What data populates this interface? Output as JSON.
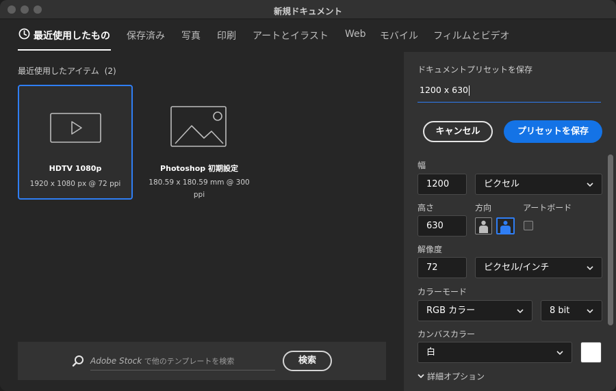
{
  "window": {
    "title": "新規ドキュメント"
  },
  "tabs": [
    {
      "label": "最近使用したもの",
      "active": true
    },
    {
      "label": "保存済み"
    },
    {
      "label": "写真"
    },
    {
      "label": "印刷"
    },
    {
      "label": "アートとイラスト"
    },
    {
      "label": "Web"
    },
    {
      "label": "モバイル"
    },
    {
      "label": "フィルムとビデオ"
    }
  ],
  "recent": {
    "title": "最近使用したアイテム",
    "count": "(2)",
    "items": [
      {
        "name": "HDTV 1080p",
        "detail": "1920 x 1080 px @ 72 ppi",
        "icon": "video-icon",
        "selected": true
      },
      {
        "name": "Photoshop 初期設定",
        "detail": "180.59 x 180.59 mm @ 300 ppi",
        "icon": "image-icon",
        "selected": false
      }
    ]
  },
  "search": {
    "placeholder_brand": "Adobe Stock",
    "placeholder_rest": " で他のテンプレートを検索",
    "button": "検索"
  },
  "preset": {
    "label": "ドキュメントプリセットを保存",
    "value": "1200 x 630",
    "cancel": "キャンセル",
    "save": "プリセットを保存"
  },
  "settings": {
    "width_label": "幅",
    "width_value": "1200",
    "width_unit": "ピクセル",
    "height_label": "高さ",
    "height_value": "630",
    "orientation_label": "方向",
    "orientation_selected": "landscape",
    "artboard_label": "アートボード",
    "artboard_checked": false,
    "resolution_label": "解像度",
    "resolution_value": "72",
    "resolution_unit": "ピクセル/インチ",
    "color_mode_label": "カラーモード",
    "color_mode": "RGB カラー",
    "bit_depth": "8 bit",
    "canvas_label": "カンバスカラー",
    "canvas_value": "白",
    "canvas_color": "#ffffff",
    "advanced_label": "詳細オプション"
  },
  "colors": {
    "accent": "#1473e6",
    "selection": "#2f7ef5"
  }
}
